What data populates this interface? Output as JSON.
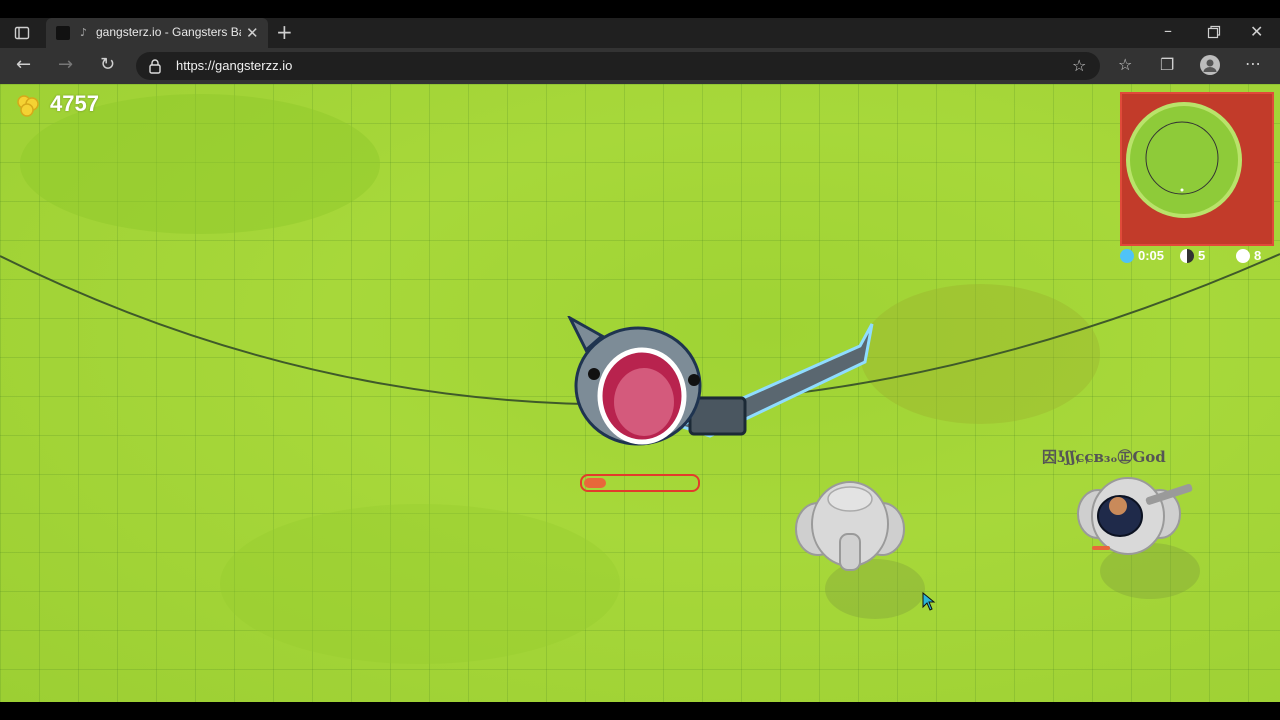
{
  "browser": {
    "tab_title": "gangsterz.io - Gangsters Batt",
    "url": "https://gangsterzz.io",
    "icons": [
      "sidebar-icon",
      "tab-favicon",
      "close-tab-icon",
      "new-tab-icon",
      "back-icon",
      "forward-icon",
      "refresh-icon",
      "lock-icon",
      "add-favorite-icon",
      "favorites-icon",
      "collections-icon",
      "profile-icon",
      "more-icon",
      "minimize-icon",
      "restore-icon",
      "close-window-icon"
    ]
  },
  "hud": {
    "coins": "4757",
    "timer": "0:05",
    "stat_two": "5",
    "stat_three": "8",
    "player_name": "因ʖʃʃɕɕʙ₃ₒ㊣God",
    "health_fraction": 0.2
  },
  "colors": {
    "grass": "#a7d83a",
    "minimap_bg": "#c23b2a",
    "health": "#e8673a",
    "health_border": "#e23b2b"
  }
}
